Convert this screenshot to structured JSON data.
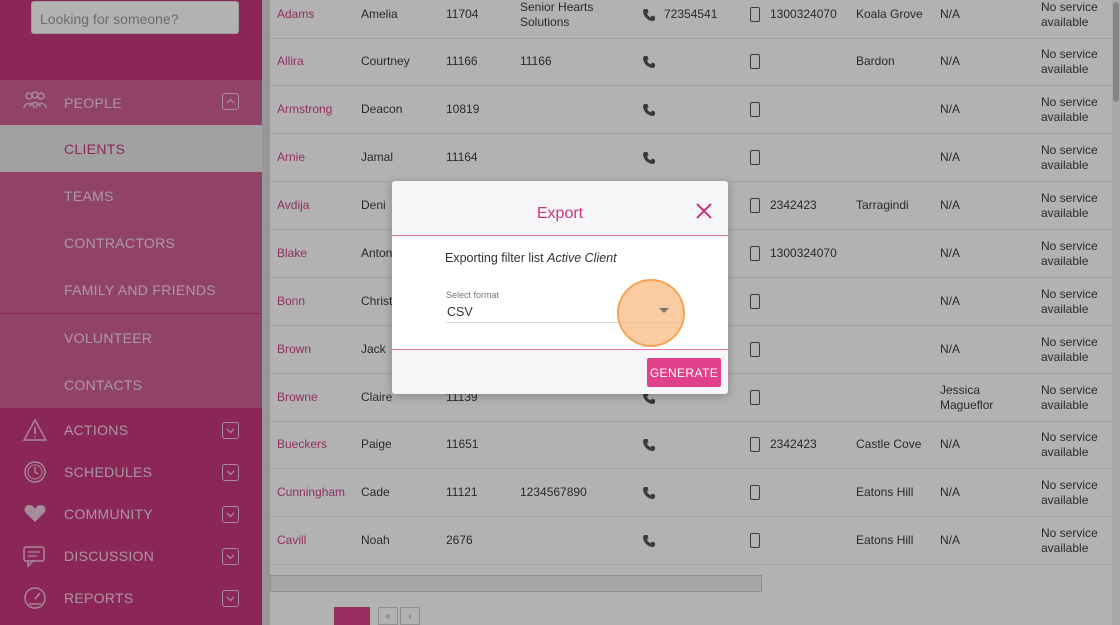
{
  "sidebar": {
    "search_placeholder": "Looking for someone?",
    "people_label": "PEOPLE",
    "sub_items": [
      {
        "label": "CLIENTS",
        "active": true
      },
      {
        "label": "TEAMS",
        "active": false
      },
      {
        "label": "CONTRACTORS",
        "active": false
      },
      {
        "label": "FAMILY AND FRIENDS",
        "active": false
      },
      {
        "label": "VOLUNTEER",
        "active": false
      },
      {
        "label": "CONTACTS",
        "active": false
      }
    ],
    "sections": [
      {
        "label": "ACTIONS",
        "icon": "warning-icon"
      },
      {
        "label": "SCHEDULES",
        "icon": "clock-icon"
      },
      {
        "label": "COMMUNITY",
        "icon": "hearts-icon"
      },
      {
        "label": "DISCUSSION",
        "icon": "chat-icon"
      },
      {
        "label": "REPORTS",
        "icon": "gauge-icon"
      }
    ]
  },
  "table": {
    "rows": [
      {
        "last": "Adams",
        "first": "Amelia",
        "id": "11704",
        "org": "Senior Hearts Solutions",
        "phone": "72354541",
        "mobile": "1300324070",
        "suburb": "Koala Grove",
        "manager": "N/A",
        "service": "No service available"
      },
      {
        "last": "Allira",
        "first": "Courtney",
        "id": "11166",
        "org": "11166",
        "phone": "",
        "mobile": "",
        "suburb": "Bardon",
        "manager": "N/A",
        "service": "No service available"
      },
      {
        "last": "Armstrong",
        "first": "Deacon",
        "id": "10819",
        "org": "",
        "phone": "",
        "mobile": "",
        "suburb": "",
        "manager": "N/A",
        "service": "No service available"
      },
      {
        "last": "Arnie",
        "first": "Jamal",
        "id": "11164",
        "org": "",
        "phone": "",
        "mobile": "",
        "suburb": "",
        "manager": "N/A",
        "service": "No service available"
      },
      {
        "last": "Avdija",
        "first": "Deni",
        "id": "",
        "org": "",
        "phone": "",
        "mobile": "2342423",
        "suburb": "Tarragindi",
        "manager": "N/A",
        "service": "No service available"
      },
      {
        "last": "Blake",
        "first": "Anton",
        "id": "",
        "org": "",
        "phone": "",
        "mobile": "1300324070",
        "suburb": "",
        "manager": "N/A",
        "service": "No service available"
      },
      {
        "last": "Bonn",
        "first": "Christ",
        "id": "",
        "org": "",
        "phone": "",
        "mobile": "",
        "suburb": "",
        "manager": "N/A",
        "service": "No service available"
      },
      {
        "last": "Brown",
        "first": "Jack",
        "id": "",
        "org": "",
        "phone": "",
        "mobile": "",
        "suburb": "",
        "manager": "N/A",
        "service": "No service available"
      },
      {
        "last": "Browne",
        "first": "Claire",
        "id": "11139",
        "org": "",
        "phone": "",
        "mobile": "",
        "suburb": "",
        "manager": "Jessica Magueflor",
        "service": "No service available"
      },
      {
        "last": "Bueckers",
        "first": "Paige",
        "id": "11651",
        "org": "",
        "phone": "",
        "mobile": "2342423",
        "suburb": "Castle Cove",
        "manager": "N/A",
        "service": "No service available"
      },
      {
        "last": "Cunningham",
        "first": "Cade",
        "id": "11121",
        "org": "1234567890",
        "phone": "",
        "mobile": "",
        "suburb": "Eatons Hill",
        "manager": "N/A",
        "service": "No service available"
      },
      {
        "last": "Cavill",
        "first": "Noah",
        "id": "2676",
        "org": "",
        "phone": "",
        "mobile": "",
        "suburb": "Eatons Hill",
        "manager": "N/A",
        "service": "No service available"
      }
    ]
  },
  "pager": {
    "first": "«",
    "prev": "‹"
  },
  "modal": {
    "title": "Export",
    "export_prefix": "Exporting filter list ",
    "export_filter": "Active Client",
    "select_label": "Select format",
    "select_value": "CSV",
    "generate_label": "GENERATE"
  },
  "colors": {
    "brand": "#c8377e",
    "accent": "#e0418a",
    "highlight": "#f5a050"
  }
}
